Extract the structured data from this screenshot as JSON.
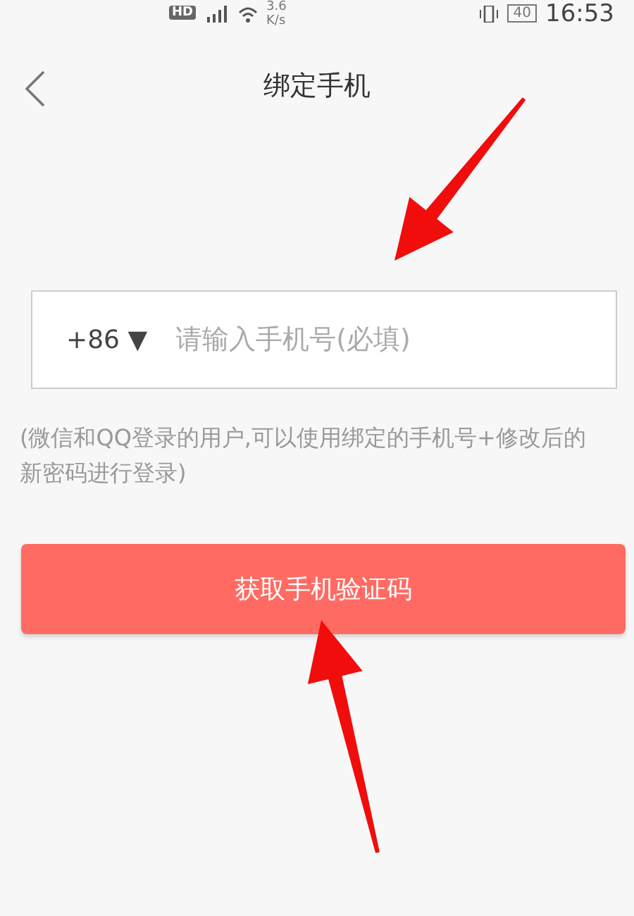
{
  "status_bar": {
    "left": [
      "HD"
    ],
    "speed": [
      "3.6",
      "K/s"
    ],
    "battery": "40",
    "time": "16:53"
  },
  "header": {
    "title": "绑定手机"
  },
  "phone_field": {
    "country_code": "+86",
    "dropdown": "▼",
    "placeholder": "请输入手机号(必填)"
  },
  "hint": "(微信和QQ登录的用户,可以使用绑定的手机号+修改后的新密码进行登录)",
  "submit_button": "获取手机验证码",
  "annotations": [
    {
      "kind": "arrow"
    },
    {
      "kind": "arrow"
    }
  ]
}
